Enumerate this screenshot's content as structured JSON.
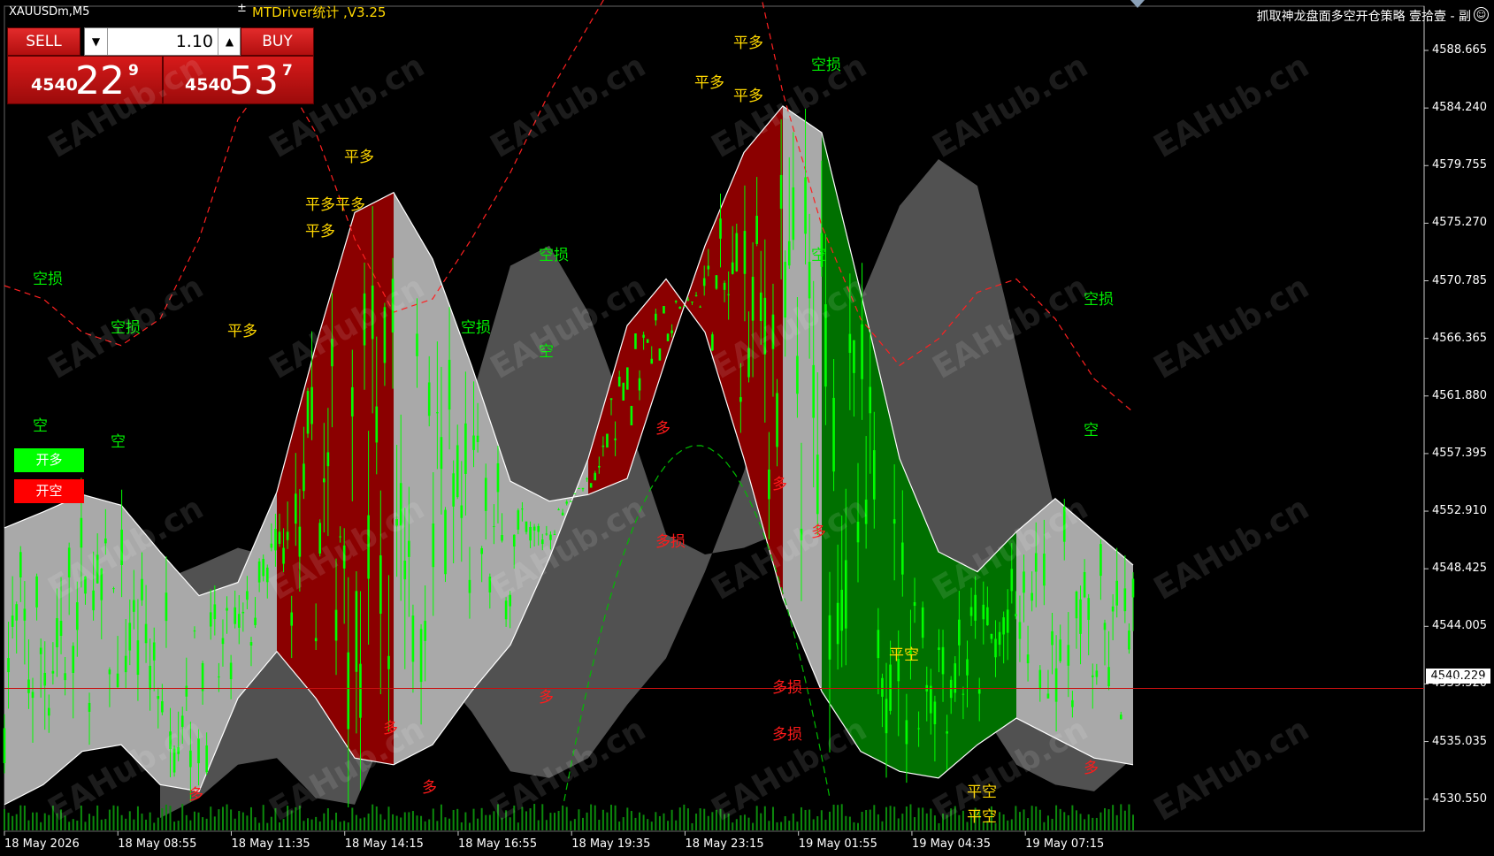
{
  "window": {
    "symbol": "XAUUSDm,M5",
    "ea_title": "MTDriver统计 ,V3.25",
    "strategy_title": "抓取神龙盘面多空开仓策略  壹拾壹 - 副"
  },
  "trade_panel": {
    "sell_label": "SELL",
    "buy_label": "BUY",
    "lot_size": "1.10",
    "sell_price": {
      "prefix": "4540",
      "big": "22",
      "sup": "9"
    },
    "buy_price": {
      "prefix": "4540",
      "big": "53",
      "sup": "7"
    }
  },
  "legend": {
    "long_label": "开多",
    "short_label": "开空",
    "long_color": "#00ff00",
    "short_color": "#ff0000"
  },
  "watermark": "EAHub.cn",
  "current_price": "4540.229",
  "colors": {
    "background": "#000000",
    "candle": "#00ff00",
    "band_neutral": "#a9a9a9",
    "band_up": "#8b0000",
    "band_down": "#007000",
    "signal_long": "#ff0000",
    "signal_close": "#ffd700",
    "signal_short": "#00ee00"
  },
  "chart_data": {
    "type": "candlestick",
    "symbol": "XAUUSDm",
    "timeframe": "M5",
    "y_ticks": [
      "4588.665",
      "4584.240",
      "4579.755",
      "4575.270",
      "4570.785",
      "4566.365",
      "4561.880",
      "4557.395",
      "4552.910",
      "4548.425",
      "4544.005",
      "4539.520",
      "4535.035",
      "4530.550"
    ],
    "x_ticks": [
      "18 May 2026",
      "18 May 08:55",
      "18 May 11:35",
      "18 May 14:15",
      "18 May 16:55",
      "18 May 19:35",
      "18 May 23:15",
      "19 May 01:55",
      "19 May 04:35",
      "19 May 07:15"
    ],
    "ylim": [
      4529.5,
      4591.5
    ],
    "current_price": 4540.229,
    "band_upper": [
      4552.3,
      4553.5,
      4554.8,
      4554.0,
      4550.5,
      4547.2,
      4548.2,
      4555.0,
      4566.0,
      4576.0,
      4577.5,
      4572.5,
      4564.5,
      4555.8,
      4554.3,
      4554.8,
      4556.0,
      4565.0,
      4573.5,
      4580.5,
      4584.0,
      4582.0,
      4570.0,
      4557.5,
      4550.5,
      4549.0,
      4552.0,
      4554.5,
      4552.0,
      4549.5
    ],
    "band_lower": [
      4531.5,
      4533.0,
      4535.5,
      4536.0,
      4533.0,
      4532.5,
      4539.5,
      4543.0,
      4539.5,
      4535.0,
      4534.5,
      4536.0,
      4540.0,
      4543.5,
      4550.0,
      4557.5,
      4567.5,
      4571.0,
      4567.0,
      4557.5,
      4547.0,
      4540.0,
      4535.5,
      4534.0,
      4533.5,
      4536.0,
      4538.0,
      4536.5,
      4535.0,
      4534.5
    ],
    "band_color_segments": [
      {
        "from_index": 0,
        "to_index": 7,
        "color": "gray"
      },
      {
        "from_index": 7,
        "to_index": 10,
        "color": "darkred"
      },
      {
        "from_index": 10,
        "to_index": 15,
        "color": "gray"
      },
      {
        "from_index": 15,
        "to_index": 20,
        "color": "darkred"
      },
      {
        "from_index": 20,
        "to_index": 21,
        "color": "gray"
      },
      {
        "from_index": 21,
        "to_index": 26,
        "color": "green"
      },
      {
        "from_index": 26,
        "to_index": 29,
        "color": "gray"
      }
    ],
    "envelope_upper": [
      4570.5,
      4569.5,
      4567.0,
      4566.0,
      4568.0,
      4574.0,
      4583.0,
      4587.0,
      4582.0,
      4574.0,
      4568.5,
      4569.5,
      4574.0,
      4579.0,
      4585.0,
      4590.0,
      4595.0,
      4600.0,
      4605.0,
      4598.0,
      4585.0,
      4575.0,
      4568.0,
      4564.5,
      4566.5,
      4570.0,
      4571.0,
      4568.0,
      4563.5,
      4561.0
    ],
    "annotations": [
      {
        "text": "空",
        "price": 4560.2,
        "time_index": 1,
        "type": "short"
      },
      {
        "text": "空",
        "price": 4559.0,
        "time_index": 3,
        "type": "short"
      },
      {
        "text": "空损",
        "price": 4571.2,
        "time_index": 1,
        "type": "short_stop"
      },
      {
        "text": "空损",
        "price": 4567.6,
        "time_index": 3,
        "type": "short_stop"
      },
      {
        "text": "平多",
        "price": 4567.3,
        "time_index": 6,
        "type": "close_long"
      },
      {
        "text": "平多",
        "price": 4574.8,
        "time_index": 8,
        "type": "close_long"
      },
      {
        "text": "平多平多",
        "price": 4576.8,
        "time_index": 8,
        "type": "close_long"
      },
      {
        "text": "平多",
        "price": 4580.4,
        "time_index": 9,
        "type": "close_long"
      },
      {
        "text": "空损",
        "price": 4567.6,
        "time_index": 12,
        "type": "short_stop"
      },
      {
        "text": "空损",
        "price": 4573.0,
        "time_index": 14,
        "type": "short_stop"
      },
      {
        "text": "空",
        "price": 4565.8,
        "time_index": 14,
        "type": "short"
      },
      {
        "text": "平多",
        "price": 4586.0,
        "time_index": 18,
        "type": "close_long"
      },
      {
        "text": "平多",
        "price": 4589.0,
        "time_index": 19,
        "type": "close_long"
      },
      {
        "text": "平多",
        "price": 4585.0,
        "time_index": 19,
        "type": "close_long"
      },
      {
        "text": "空损",
        "price": 4587.3,
        "time_index": 21,
        "type": "short_stop"
      },
      {
        "text": "空",
        "price": 4573.0,
        "time_index": 21,
        "type": "short"
      },
      {
        "text": "空损",
        "price": 4569.7,
        "time_index": 28,
        "type": "short_stop"
      },
      {
        "text": "空",
        "price": 4559.9,
        "time_index": 28,
        "type": "short"
      },
      {
        "text": "多",
        "price": 4532.5,
        "time_index": 5,
        "type": "long"
      },
      {
        "text": "多",
        "price": 4537.5,
        "time_index": 10,
        "type": "long"
      },
      {
        "text": "多",
        "price": 4533.0,
        "time_index": 11,
        "type": "long"
      },
      {
        "text": "多",
        "price": 4539.8,
        "time_index": 14,
        "type": "long"
      },
      {
        "text": "多",
        "price": 4560.0,
        "time_index": 17,
        "type": "long"
      },
      {
        "text": "多损",
        "price": 4551.5,
        "time_index": 17,
        "type": "long_stop"
      },
      {
        "text": "多",
        "price": 4555.8,
        "time_index": 20,
        "type": "long"
      },
      {
        "text": "多",
        "price": 4552.2,
        "time_index": 21,
        "type": "long"
      },
      {
        "text": "多损",
        "price": 4540.5,
        "time_index": 20,
        "type": "long_stop"
      },
      {
        "text": "多损",
        "price": 4537.0,
        "time_index": 20,
        "type": "long_stop"
      },
      {
        "text": "平空",
        "price": 4543.0,
        "time_index": 23,
        "type": "close_short"
      },
      {
        "text": "平空",
        "price": 4532.7,
        "time_index": 25,
        "type": "close_short"
      },
      {
        "text": "平空",
        "price": 4530.8,
        "time_index": 25,
        "type": "close_short"
      },
      {
        "text": "多",
        "price": 4534.5,
        "time_index": 28,
        "type": "long"
      }
    ],
    "grid": false
  }
}
